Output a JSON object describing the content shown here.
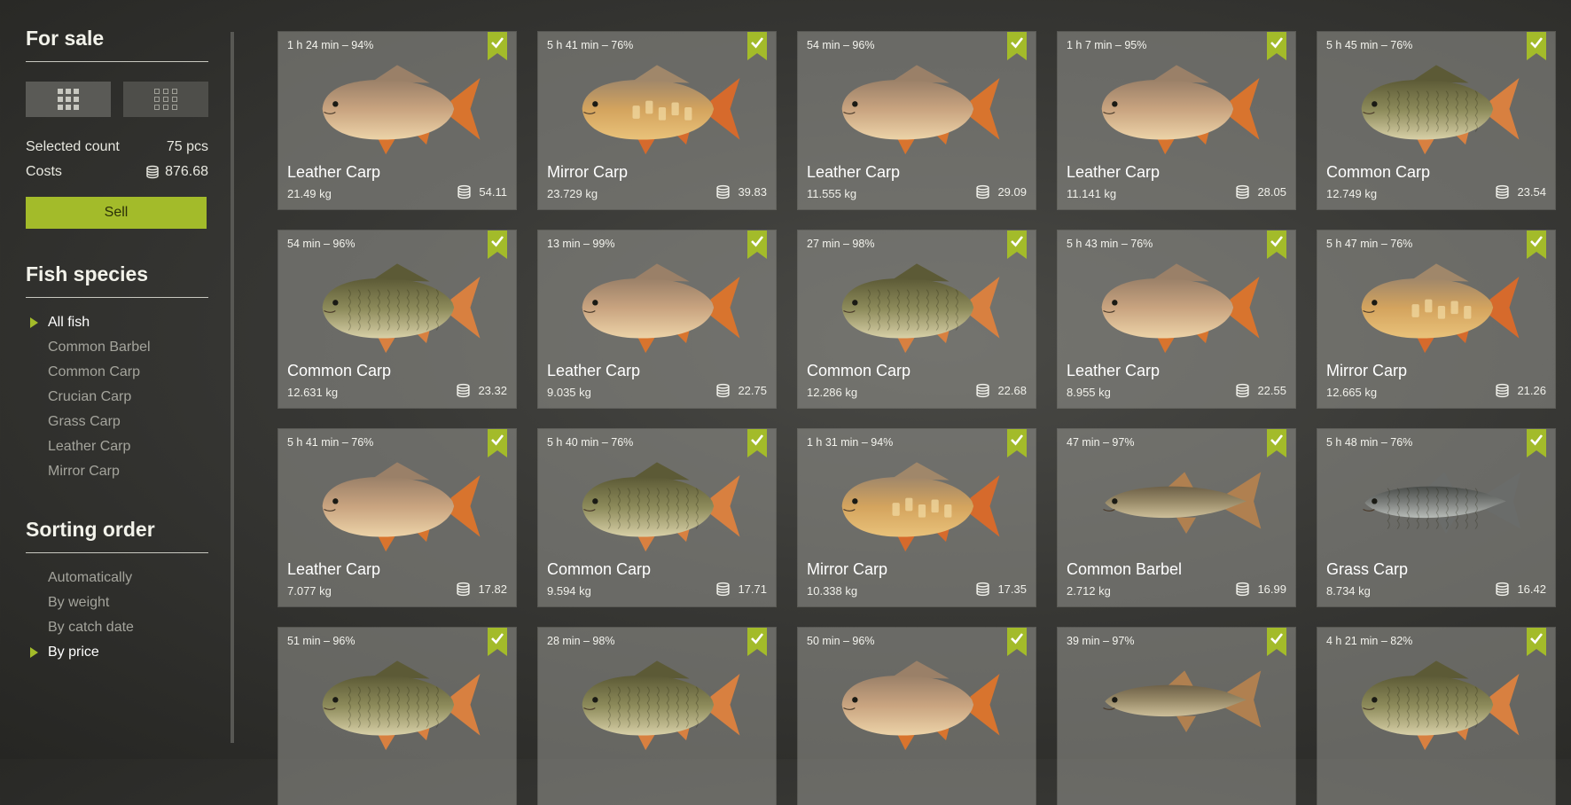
{
  "sidebar": {
    "title": "For sale",
    "selected_count_label": "Selected count",
    "selected_count_value": "75 pcs",
    "costs_label": "Costs",
    "costs_value": "876.68",
    "sell_label": "Sell",
    "species_title": "Fish species",
    "species": [
      {
        "label": "All fish",
        "active": true
      },
      {
        "label": "Common Barbel",
        "active": false
      },
      {
        "label": "Common Carp",
        "active": false
      },
      {
        "label": "Crucian Carp",
        "active": false
      },
      {
        "label": "Grass Carp",
        "active": false
      },
      {
        "label": "Leather Carp",
        "active": false
      },
      {
        "label": "Mirror Carp",
        "active": false
      }
    ],
    "sorting_title": "Sorting order",
    "sorting": [
      {
        "label": "Automatically",
        "active": false
      },
      {
        "label": "By weight",
        "active": false
      },
      {
        "label": "By catch date",
        "active": false
      },
      {
        "label": "By price",
        "active": true
      }
    ]
  },
  "colors": {
    "accent": "#a3bb2a",
    "card_bg": "#8a8a84",
    "panel_bg": "#373734"
  },
  "icons": {
    "view_large": "grid-large-icon",
    "view_small": "grid-small-icon",
    "coin": "coin-stack-icon",
    "check": "checkmark-ribbon-icon",
    "bullet": "triangle-right-icon"
  },
  "fish": [
    {
      "time": "1 h 24 min – 94%",
      "name": "Leather Carp",
      "weight": "21.49 kg",
      "price": "54.11",
      "kind": "leather",
      "checked": true
    },
    {
      "time": "5 h 41 min – 76%",
      "name": "Mirror Carp",
      "weight": "23.729 kg",
      "price": "39.83",
      "kind": "mirror",
      "checked": true
    },
    {
      "time": "54 min – 96%",
      "name": "Leather Carp",
      "weight": "11.555 kg",
      "price": "29.09",
      "kind": "leather",
      "checked": true
    },
    {
      "time": "1 h 7 min – 95%",
      "name": "Leather Carp",
      "weight": "11.141 kg",
      "price": "28.05",
      "kind": "leather",
      "checked": true
    },
    {
      "time": "5 h 45 min – 76%",
      "name": "Common Carp",
      "weight": "12.749 kg",
      "price": "23.54",
      "kind": "common",
      "checked": true
    },
    {
      "time": "54 min – 96%",
      "name": "Common Carp",
      "weight": "12.631 kg",
      "price": "23.32",
      "kind": "common",
      "checked": true
    },
    {
      "time": "13 min – 99%",
      "name": "Leather Carp",
      "weight": "9.035 kg",
      "price": "22.75",
      "kind": "leather",
      "checked": true
    },
    {
      "time": "27 min – 98%",
      "name": "Common Carp",
      "weight": "12.286 kg",
      "price": "22.68",
      "kind": "common",
      "checked": true
    },
    {
      "time": "5 h 43 min – 76%",
      "name": "Leather Carp",
      "weight": "8.955 kg",
      "price": "22.55",
      "kind": "leather",
      "checked": true
    },
    {
      "time": "5 h 47 min – 76%",
      "name": "Mirror Carp",
      "weight": "12.665 kg",
      "price": "21.26",
      "kind": "mirror",
      "checked": true
    },
    {
      "time": "5 h 41 min – 76%",
      "name": "Leather Carp",
      "weight": "7.077 kg",
      "price": "17.82",
      "kind": "leather",
      "checked": true
    },
    {
      "time": "5 h 40 min – 76%",
      "name": "Common Carp",
      "weight": "9.594 kg",
      "price": "17.71",
      "kind": "common",
      "checked": true
    },
    {
      "time": "1 h 31 min – 94%",
      "name": "Mirror Carp",
      "weight": "10.338 kg",
      "price": "17.35",
      "kind": "mirror",
      "checked": true
    },
    {
      "time": "47 min – 97%",
      "name": "Common Barbel",
      "weight": "2.712 kg",
      "price": "16.99",
      "kind": "barbel",
      "checked": true
    },
    {
      "time": "5 h 48 min – 76%",
      "name": "Grass Carp",
      "weight": "8.734 kg",
      "price": "16.42",
      "kind": "grass",
      "checked": true
    },
    {
      "time": "51 min – 96%",
      "name": "",
      "weight": "",
      "price": "",
      "kind": "common",
      "checked": true
    },
    {
      "time": "28 min – 98%",
      "name": "",
      "weight": "",
      "price": "",
      "kind": "common",
      "checked": true
    },
    {
      "time": "50 min – 96%",
      "name": "",
      "weight": "",
      "price": "",
      "kind": "leather",
      "checked": true
    },
    {
      "time": "39 min – 97%",
      "name": "",
      "weight": "",
      "price": "",
      "kind": "barbel",
      "checked": true
    },
    {
      "time": "4 h 21 min – 82%",
      "name": "",
      "weight": "",
      "price": "",
      "kind": "common",
      "checked": true
    }
  ]
}
